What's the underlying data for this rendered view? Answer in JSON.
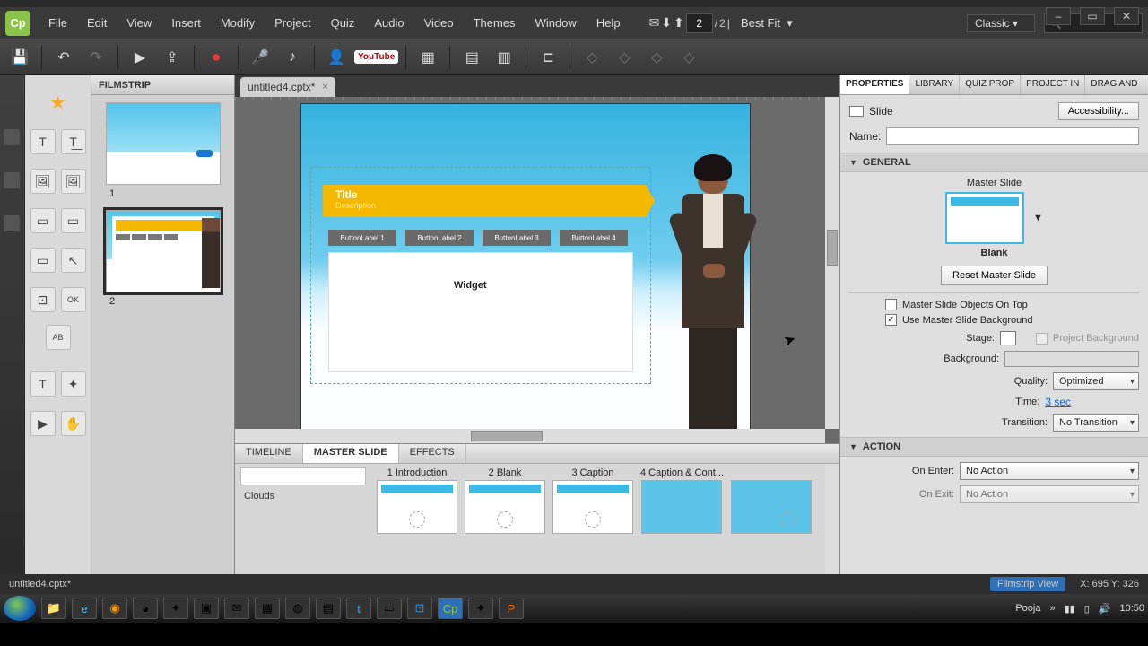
{
  "window": {
    "minimize": "–",
    "maximize": "▭",
    "close": "✕"
  },
  "menubar": {
    "logo": "Cp",
    "items": [
      "File",
      "Edit",
      "View",
      "Insert",
      "Modify",
      "Project",
      "Quiz",
      "Audio",
      "Video",
      "Themes",
      "Window",
      "Help"
    ],
    "page_current": "2",
    "page_total": "2",
    "zoom": "Best Fit",
    "workspace": "Classic"
  },
  "toolbar": {
    "youtube": "YouTube"
  },
  "doc_tab": {
    "name": "untitled4.cptx*",
    "close": "×"
  },
  "filmstrip": {
    "title": "FILMSTRIP",
    "slides": [
      "1",
      "2"
    ]
  },
  "stage": {
    "title": "Title",
    "subtitle": "Description",
    "buttons": [
      "ButtonLabel 1",
      "ButtonLabel 2",
      "ButtonLabel 3",
      "ButtonLabel 4"
    ],
    "widget": "Widget"
  },
  "bottom": {
    "tabs": [
      "TIMELINE",
      "MASTER SLIDE",
      "EFFECTS"
    ],
    "group": "Clouds",
    "items": [
      "1 Introduction",
      "2 Blank",
      "3 Caption",
      "4 Caption & Cont..."
    ]
  },
  "props": {
    "tabs": [
      "PROPERTIES",
      "LIBRARY",
      "QUIZ PROP",
      "PROJECT IN",
      "DRAG AND"
    ],
    "slide_label": "Slide",
    "accessibility": "Accessibility...",
    "name_label": "Name:",
    "general": "GENERAL",
    "master_slide": "Master Slide",
    "master_name": "Blank",
    "reset": "Reset Master Slide",
    "ms_on_top": "Master Slide Objects On Top",
    "ms_bg": "Use Master Slide Background",
    "stage": "Stage:",
    "project_bg": "Project Background",
    "background": "Background:",
    "quality": "Quality:",
    "quality_v": "Optimized",
    "time": "Time:",
    "time_v": "3 sec",
    "transition": "Transition:",
    "transition_v": "No Transition",
    "action": "ACTION",
    "on_enter": "On Enter:",
    "on_enter_v": "No Action",
    "on_exit": "On Exit:",
    "on_exit_v": "No Action"
  },
  "status": {
    "file": "untitled4.cptx*",
    "view": "Filmstrip View",
    "coords": "X: 695 Y: 326"
  },
  "taskbar": {
    "user": "Pooja",
    "time": "10:50"
  }
}
